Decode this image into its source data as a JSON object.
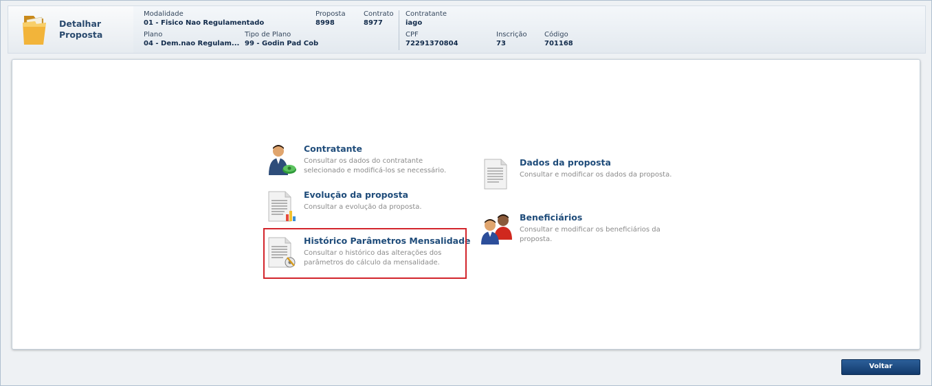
{
  "header": {
    "title": "Detalhar Proposta",
    "fields": {
      "modalidade": {
        "label": "Modalidade",
        "value": "01 - Fisico Nao Regulamentado"
      },
      "proposta": {
        "label": "Proposta",
        "value": "8998"
      },
      "contrato": {
        "label": "Contrato",
        "value": "8977"
      },
      "contratante": {
        "label": "Contratante",
        "value": "iago"
      },
      "plano": {
        "label": "Plano",
        "value": "04 - Dem.nao Regulam..."
      },
      "tipo_plano": {
        "label": "Tipo de Plano",
        "value": "99 - Godin Pad Cob"
      },
      "cpf": {
        "label": "CPF",
        "value": "72291370804"
      },
      "inscricao": {
        "label": "Inscrição",
        "value": "73"
      },
      "codigo": {
        "label": "Código",
        "value": "701168"
      }
    }
  },
  "menu": {
    "contratante": {
      "title": "Contratante",
      "desc": "Consultar os dados do contratante selecionado e modificá-los se necessário.",
      "icon": "user-money-icon"
    },
    "evolucao": {
      "title": "Evolução da proposta",
      "desc": "Consultar a evolução da proposta.",
      "icon": "document-chart-icon"
    },
    "historico": {
      "title": "Histórico Parâmetros Mensalidade",
      "desc": "Consultar o histórico das alterações dos parâmetros do cálculo da mensalidade.",
      "icon": "document-gear-icon"
    },
    "dados": {
      "title": "Dados da proposta",
      "desc": "Consultar e modificar os dados da proposta.",
      "icon": "document-icon"
    },
    "beneficiarios": {
      "title": "Beneficiários",
      "desc": "Consultar e modificar os beneficiários da proposta.",
      "icon": "users-icon"
    }
  },
  "footer": {
    "back_label": "Voltar"
  },
  "colors": {
    "accent": "#1f4c7a",
    "highlight": "#d2232a",
    "button": "#1a4880"
  }
}
